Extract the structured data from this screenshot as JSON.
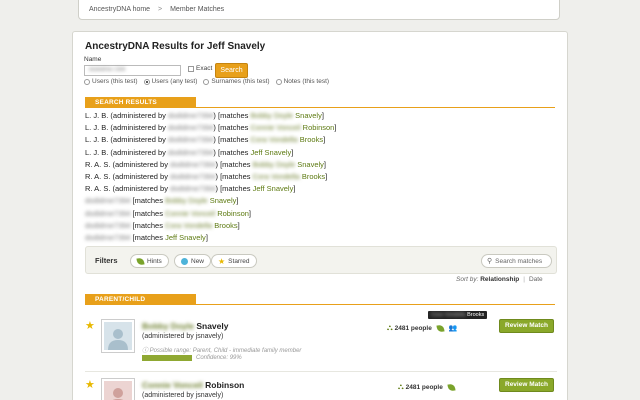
{
  "breadcrumb": {
    "home": "AncestryDNA home",
    "separator": ">",
    "current": "Member Matches"
  },
  "page": {
    "title": "AncestryDNA Results for Jeff Snavely"
  },
  "search": {
    "name_label": "Name",
    "name_value": "dodidme7394",
    "exact_label": "Exact",
    "button_label": "Search",
    "scopes": [
      {
        "label": "Users (this test)",
        "selected": false
      },
      {
        "label": "Users (any test)",
        "selected": true
      },
      {
        "label": "Surnames (this test)",
        "selected": false
      },
      {
        "label": "Notes (this test)",
        "selected": false
      }
    ]
  },
  "search_results": {
    "header": "SEARCH RESULTS",
    "rows": [
      {
        "prefix": "L. J. B. (administered by ",
        "admin": "dodidme7394",
        "mid": ") [matches ",
        "match_first": "Bobby Doyle",
        "match_last": "Snavely",
        "suffix": "]"
      },
      {
        "prefix": "L. J. B. (administered by ",
        "admin": "dodidme7394",
        "mid": ") [matches ",
        "match_first": "Connie Vonceil",
        "match_last": "Robinson",
        "suffix": "]"
      },
      {
        "prefix": "L. J. B. (administered by ",
        "admin": "dodidme7394",
        "mid": ") [matches ",
        "match_first": "Cora Vondella",
        "match_last": "Brooks",
        "suffix": "]"
      },
      {
        "prefix": "L. J. B. (administered by ",
        "admin": "dodidme7394",
        "mid": ") [matches ",
        "match_first": "",
        "match_last": "Jeff Snavely",
        "suffix": "]"
      },
      {
        "prefix": "R. A. S. (administered by ",
        "admin": "dodidme7394",
        "mid": ") [matches ",
        "match_first": "Bobby Doyle",
        "match_last": "Snavely",
        "suffix": "]"
      },
      {
        "prefix": "R. A. S. (administered by ",
        "admin": "dodidme7394",
        "mid": ") [matches ",
        "match_first": "Cora Vondella",
        "match_last": "Brooks",
        "suffix": "]"
      },
      {
        "prefix": "R. A. S. (administered by ",
        "admin": "dodidme7394",
        "mid": ") [matches ",
        "match_first": "",
        "match_last": "Jeff Snavely",
        "suffix": "]"
      },
      {
        "prefix": "",
        "admin": "dodidme7394",
        "mid": " [matches ",
        "match_first": "Bobby Doyle",
        "match_last": "Snavely",
        "suffix": "]"
      },
      {
        "prefix": "",
        "admin": "dodidme7394",
        "mid": " [matches ",
        "match_first": "Connie Vonceil",
        "match_last": "Robinson",
        "suffix": "]"
      },
      {
        "prefix": "",
        "admin": "dodidme7394",
        "mid": " [matches ",
        "match_first": "Cora Vondella",
        "match_last": "Brooks",
        "suffix": "]"
      },
      {
        "prefix": "",
        "admin": "dodidme7394",
        "mid": " [matches ",
        "match_first": "",
        "match_last": "Jeff Snavely",
        "suffix": "]"
      }
    ]
  },
  "filters": {
    "label": "Filters",
    "hints": "Hints",
    "new": "New",
    "starred": "Starred",
    "search_placeholder": "Search matches"
  },
  "sort": {
    "label": "Sort by:",
    "active": "Relationship",
    "other": "Date"
  },
  "group": {
    "header": "PARENT/CHILD"
  },
  "matches": [
    {
      "first_name": "Bobby Doyle",
      "last_name": "Snavely",
      "admin": "(administered by jsnavely)",
      "range": "Possible range: Parent, Child - immediate family member",
      "confidence": "Confidence: 99%",
      "people": "2481 people",
      "tooltip_first": "Cora Vondella",
      "tooltip_last": "Brooks",
      "review": "Review Match"
    },
    {
      "first_name": "Connie Vonceil",
      "last_name": "Robinson",
      "admin": "(administered by jsnavely)",
      "people": "2481 people",
      "review": "Review Match"
    }
  ],
  "colors": {
    "accent": "#e8a01a",
    "green": "#8aa82a",
    "match_link": "#5d7a11",
    "star": "#e8b800"
  }
}
